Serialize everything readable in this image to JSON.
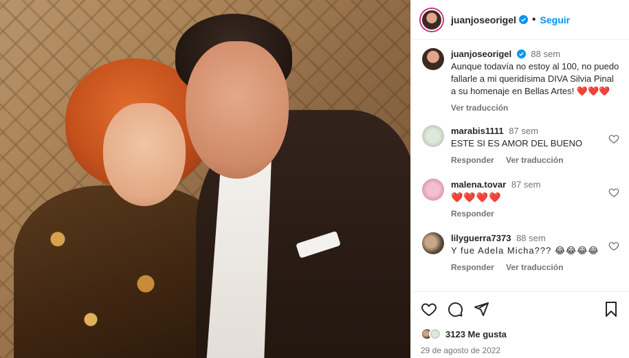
{
  "post": {
    "username": "juanjoseorigel",
    "follow_label": "Seguir",
    "dot": "•"
  },
  "caption": {
    "username": "juanjoseorigel",
    "time": "88 sem",
    "text": "Aunque todavía no estoy al 100, no puedo fallarle a mi queridísima DIVA Silvia Pinal a su homenaje en Bellas Artes! ❤️❤️❤️",
    "translate_label": "Ver traducción"
  },
  "comments": [
    {
      "username": "marabis1111",
      "time": "87 sem",
      "text": "ESTE SI ES AMOR DEL BUENO",
      "reply_label": "Responder",
      "translate_label": "Ver traducción"
    },
    {
      "username": "malena.tovar",
      "time": "87 sem",
      "text": "❤️❤️❤️❤️",
      "reply_label": "Responder"
    },
    {
      "username": "lilyguerra7373",
      "time": "88 sem",
      "text": "Y fue Adela Micha??? 😂😂😂😂",
      "reply_label": "Responder",
      "translate_label": "Ver traducción"
    }
  ],
  "footer": {
    "likes": "3123 Me gusta",
    "date": "29 de agosto de 2022"
  },
  "colors": {
    "accent": "#0095f6",
    "heart": "#ed1c35",
    "muted": "#737373"
  }
}
